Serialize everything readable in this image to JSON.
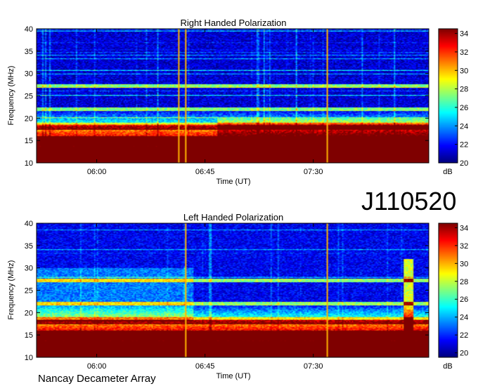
{
  "page": {
    "event_id": "J110520",
    "footer": "Nancay Decameter Array"
  },
  "chart_data": [
    {
      "type": "heatmap",
      "title": "Right Handed Polarization",
      "xlabel": "Time (UT)",
      "ylabel": "Frequency (MHz)",
      "x_ticks": [
        "06:00",
        "06:45",
        "07:30"
      ],
      "x_range_minutes": [
        335,
        498
      ],
      "x_tick_minutes": [
        360,
        405,
        450
      ],
      "y_ticks": [
        10,
        15,
        20,
        25,
        30,
        35,
        40
      ],
      "ylim": [
        10,
        40
      ],
      "colorbar": {
        "label": "dB",
        "ticks": [
          20,
          22,
          24,
          26,
          28,
          30,
          32,
          34
        ],
        "range": [
          20,
          34.5
        ]
      },
      "vertical_lines_minutes": [
        394,
        397,
        456
      ],
      "grid": false
    },
    {
      "type": "heatmap",
      "title": "Left Handed Polarization",
      "xlabel": "Time (UT)",
      "ylabel": "Frequency (MHz)",
      "x_ticks": [
        "06:00",
        "06:45",
        "07:30"
      ],
      "x_range_minutes": [
        335,
        498
      ],
      "x_tick_minutes": [
        360,
        405,
        450
      ],
      "y_ticks": [
        10,
        15,
        20,
        25,
        30,
        35,
        40
      ],
      "ylim": [
        10,
        40
      ],
      "colorbar": {
        "label": "dB",
        "ticks": [
          20,
          22,
          24,
          26,
          28,
          30,
          32,
          34
        ],
        "range": [
          19.5,
          34.5
        ]
      },
      "vertical_lines_minutes": [
        397,
        456
      ],
      "burst_minutes": 490,
      "grid": false
    }
  ]
}
